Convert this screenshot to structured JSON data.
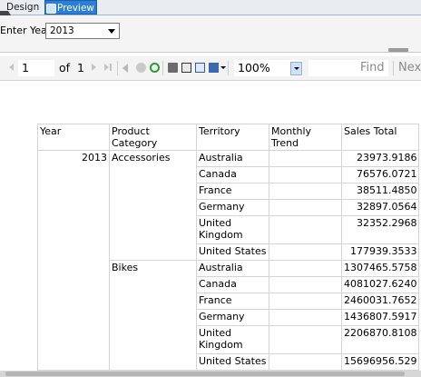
{
  "tabs": {
    "design": "Design",
    "preview": "Preview"
  },
  "parameters": {
    "year_label": "Enter Year",
    "year_value": "2013"
  },
  "toolbar": {
    "page_current": "1",
    "page_of": "of",
    "page_total": "1",
    "zoom": "100%",
    "find": "Find",
    "next": "Next"
  },
  "report": {
    "headers": [
      "Year",
      "Product Category",
      "Territory",
      "Monthly Trend",
      "Sales Total"
    ],
    "year": "2013",
    "groups": [
      {
        "category": "Accessories",
        "rows": [
          {
            "territory": "Australia",
            "sales": "23973.9186"
          },
          {
            "territory": "Canada",
            "sales": "76576.0721"
          },
          {
            "territory": "France",
            "sales": "38511.4850"
          },
          {
            "territory": "Germany",
            "sales": "32897.0564"
          },
          {
            "territory": "United Kingdom",
            "sales": "32352.2968"
          },
          {
            "territory": "United States",
            "sales": "177939.3533"
          }
        ]
      },
      {
        "category": "Bikes",
        "rows": [
          {
            "territory": "Australia",
            "sales": "1307465.5758"
          },
          {
            "territory": "Canada",
            "sales": "4081027.6240"
          },
          {
            "territory": "France",
            "sales": "2460031.7652"
          },
          {
            "territory": "Germany",
            "sales": "1436807.5917"
          },
          {
            "territory": "United Kingdom",
            "sales": "2206870.8108"
          },
          {
            "territory": "United States",
            "sales": "15696956.529"
          }
        ]
      }
    ]
  }
}
